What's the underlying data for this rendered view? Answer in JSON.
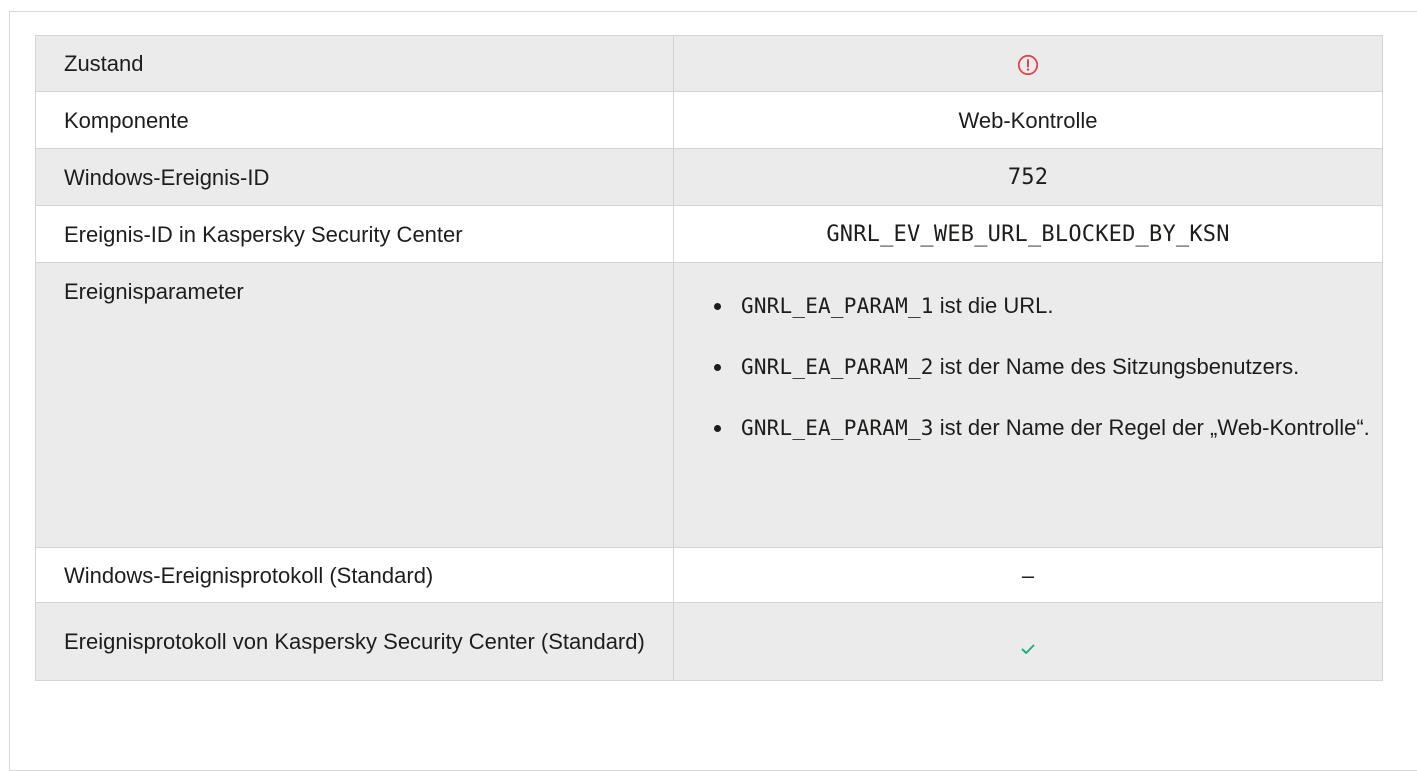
{
  "colors": {
    "warning_icon": "#e0454d",
    "check_icon": "#1aab7e",
    "row_shade": "#ebebeb",
    "border": "#d4d4d4"
  },
  "rows": {
    "state": {
      "label": "Zustand",
      "icon": "warning-circle-icon"
    },
    "component": {
      "label": "Komponente",
      "value": "Web-Kontrolle"
    },
    "windows_event_id": {
      "label": "Windows-Ereignis-ID",
      "value": "752"
    },
    "ksc_event_id": {
      "label": "Ereignis-ID in Kaspersky Security Center",
      "value": "GNRL_EV_WEB_URL_BLOCKED_BY_KSN"
    },
    "event_params": {
      "label": "Ereignisparameter",
      "items": [
        {
          "code": "GNRL_EA_PARAM_1",
          "text": " ist die URL."
        },
        {
          "code": "GNRL_EA_PARAM_2",
          "text": " ist der Name des Sitzungsbenutzers."
        },
        {
          "code": "GNRL_EA_PARAM_3",
          "text": " ist der Name der Regel der „Web-Kontrolle“."
        }
      ]
    },
    "windows_log": {
      "label": "Windows-Ereignisprotokoll (Standard)",
      "value": "–"
    },
    "ksc_log": {
      "label": "Ereignisprotokoll von Kaspersky Security Center (Standard)",
      "icon": "checkmark-icon"
    }
  }
}
